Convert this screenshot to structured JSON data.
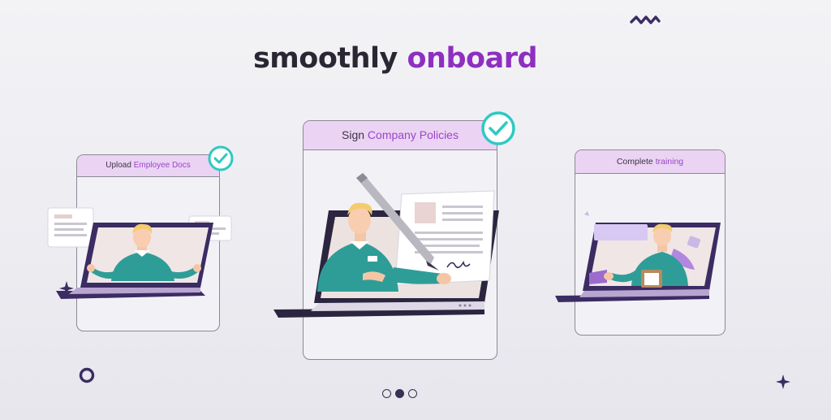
{
  "headline": {
    "part1": "smoothly",
    "part2": "onboard"
  },
  "cards": [
    {
      "label_plain": "Upload",
      "label_highlight": "Employee Docs",
      "checked": true
    },
    {
      "label_plain": "Sign",
      "label_highlight": "Company Policies",
      "checked": true
    },
    {
      "label_plain": "Complete",
      "label_highlight": "training",
      "checked": false
    }
  ],
  "carousel": {
    "total": 3,
    "active_index": 1
  },
  "colors": {
    "accent": "#8e2fc0",
    "header_bg": "#ebd3f4",
    "check_teal": "#2ec9c3",
    "laptop_dark": "#2b2540",
    "shirt_teal": "#2f9d97"
  },
  "icons": [
    "check-icon",
    "zigzag-icon",
    "sparkle-icon",
    "ring-icon",
    "pen-icon"
  ]
}
